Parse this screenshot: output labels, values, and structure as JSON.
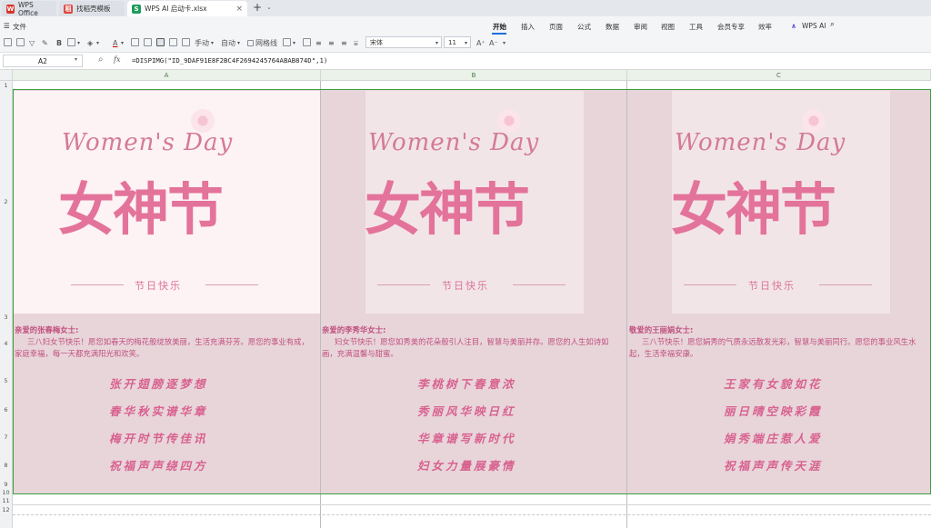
{
  "tabs": [
    {
      "label": "WPS Office",
      "icon_color": "#d9342b"
    },
    {
      "label": "找稻壳模板",
      "icon_color": "#e0433b"
    },
    {
      "label": "WPS AI 启动卡.xlsx",
      "icon_color": "#1d9c5b"
    }
  ],
  "tab_icon_glyphs": [
    "W",
    "稻",
    "S"
  ],
  "file_menu": "文件",
  "menu": [
    "开始",
    "插入",
    "页面",
    "公式",
    "数据",
    "审阅",
    "视图",
    "工具",
    "会员专享",
    "效率",
    "WPS AI"
  ],
  "toolbar": {
    "manual": "手动",
    "auto": "自动",
    "gridlines": "网格线",
    "font": "宋体",
    "font_size": "11"
  },
  "formula_bar": {
    "cell_ref": "A2",
    "fx": "fx",
    "formula": "=DISPIMG(\"ID_9DAF91E8F2BC4F2694245764ABAB874D\",1)"
  },
  "columns": [
    "A",
    "B",
    "C"
  ],
  "rows": [
    "1",
    "2",
    "3",
    "4",
    "5",
    "6",
    "7",
    "8",
    "9",
    "10",
    "11",
    "12"
  ],
  "cards": [
    {
      "poster_script": "Women's Day",
      "poster_title": "女神节",
      "poster_sub": "节日快乐",
      "greeting": "亲爱的张春梅女士:",
      "message": "三八妇女节快乐！愿您如春天的梅花般绽放美丽，生活充满芬芳。愿您的事业有成，家庭幸福，每一天都充满阳光和欢笑。",
      "verses": [
        "张开翅膀逐梦想",
        "春华秋实谱华章",
        "梅开时节传佳讯",
        "祝福声声绕四方"
      ]
    },
    {
      "poster_script": "Women's Day",
      "poster_title": "女神节",
      "poster_sub": "节日快乐",
      "greeting": "亲爱的李秀华女士:",
      "message": "妇女节快乐！愿您如秀美的花朵般引人注目，智慧与美丽并存。愿您的人生如诗如画，充满温馨与甜蜜。",
      "verses": [
        "李桃树下春意浓",
        "秀丽风华映日红",
        "华章谱写新时代",
        "妇女力量展豪情"
      ]
    },
    {
      "poster_script": "Women's Day",
      "poster_title": "女神节",
      "poster_sub": "节日快乐",
      "greeting": "敬爱的王丽娟女士:",
      "message": "三八节快乐！愿您娟秀的气质永远散发光彩，智慧与美丽同行。愿您的事业风生水起，生活幸福安康。",
      "verses": [
        "王家有女貌如花",
        "丽日晴空映彩霞",
        "娟秀端庄惹人爱",
        "祝福声声传天涯"
      ]
    }
  ],
  "colors": {
    "accent": "#1e6fd9",
    "selection": "#3aa03a",
    "cell_bg": "#e8d5da",
    "text_pink": "#c0507e"
  }
}
